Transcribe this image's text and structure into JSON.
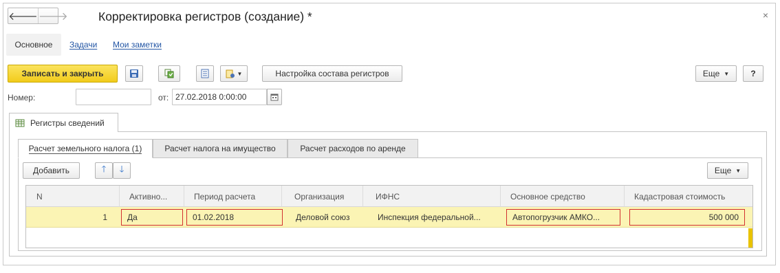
{
  "window": {
    "title": "Корректировка регистров (создание) *",
    "back_glyph": "🡐",
    "forward_glyph": "🡒",
    "close_glyph": "×"
  },
  "sections": {
    "main": "Основное",
    "tasks": "Задачи",
    "notes": "Мои заметки"
  },
  "toolbar": {
    "save_close": "Записать и закрыть",
    "register_setup": "Настройка состава регистров",
    "more": "Еще",
    "help": "?",
    "icons": [
      "save-icon",
      "post-icon",
      "document-list-icon",
      "create-based-on-icon"
    ]
  },
  "fields": {
    "number_label": "Номер:",
    "number_value": "",
    "date_label": "от:",
    "date_value": "27.02.2018  0:00:00"
  },
  "register_tab": "Регистры сведений",
  "subtabs": [
    "Расчет земельного налога (1)",
    "Расчет налога на имущество",
    "Расчет расходов по аренде"
  ],
  "table_toolbar": {
    "add": "Добавить",
    "more": "Еще"
  },
  "table": {
    "columns": [
      "N",
      "Активно...",
      "Период расчета",
      "Организация",
      "ИФНС",
      "Основное средство",
      "Кадастровая стоимость"
    ],
    "rows": [
      {
        "n": "1",
        "active": "Да",
        "period": "01.02.2018",
        "org": "Деловой союз",
        "ifns": "Инспекция федеральной...",
        "asset": "Автопогрузчик АМКО...",
        "cadastral": "500 000"
      }
    ]
  },
  "colors": {
    "primary_button": "#f2cc1c",
    "selected_row": "#fbf4b4",
    "error_border": "#d23030",
    "link": "#2255a4"
  }
}
